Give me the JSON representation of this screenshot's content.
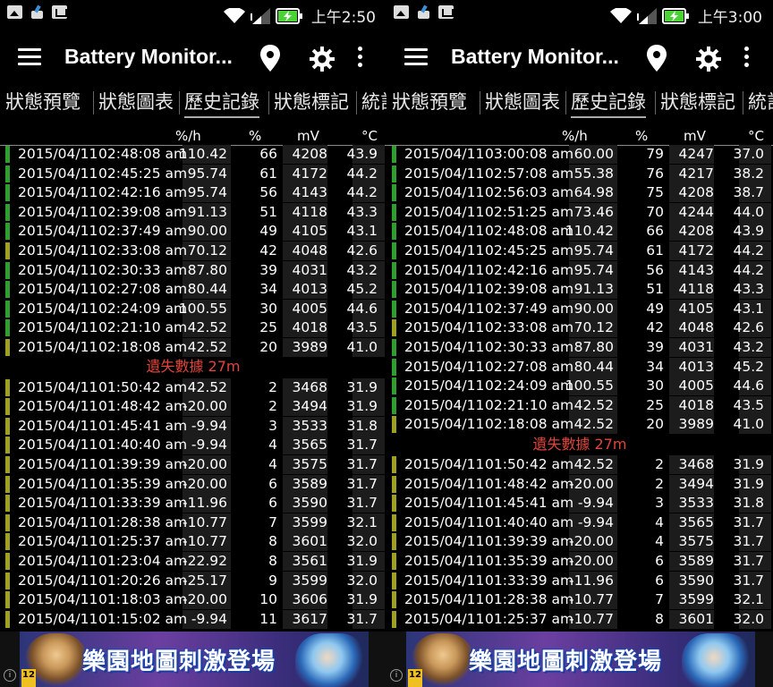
{
  "colors": {
    "bar_green": "#2e9e2e",
    "bar_olive": "#a0a020",
    "missing_text": "#e0453a"
  },
  "screens": [
    {
      "status": {
        "time": "上午2:50"
      },
      "app_title": "Battery Monitor...",
      "tabs": [
        "狀態預覽",
        "狀態圖表",
        "歷史記錄",
        "狀態標記",
        "統計"
      ],
      "active_tab": 2,
      "headers": {
        "rate": "%/h",
        "pct": "%",
        "mv": "mV",
        "temp": "°C"
      },
      "missing_label": "遺失數據 27m",
      "rows_before": [
        {
          "date": "2015/04/11",
          "time": "02:48:08 am",
          "rate": "110.42",
          "pct": "66",
          "mv": "4208",
          "temp": "43.9",
          "bar": "green"
        },
        {
          "date": "2015/04/11",
          "time": "02:45:25 am",
          "rate": "95.74",
          "pct": "61",
          "mv": "4172",
          "temp": "44.2",
          "bar": "green"
        },
        {
          "date": "2015/04/11",
          "time": "02:42:16 am",
          "rate": "95.74",
          "pct": "56",
          "mv": "4143",
          "temp": "44.2",
          "bar": "green"
        },
        {
          "date": "2015/04/11",
          "time": "02:39:08 am",
          "rate": "91.13",
          "pct": "51",
          "mv": "4118",
          "temp": "43.3",
          "bar": "green"
        },
        {
          "date": "2015/04/11",
          "time": "02:37:49 am",
          "rate": "90.00",
          "pct": "49",
          "mv": "4105",
          "temp": "43.1",
          "bar": "green"
        },
        {
          "date": "2015/04/11",
          "time": "02:33:08 am",
          "rate": "70.12",
          "pct": "42",
          "mv": "4048",
          "temp": "42.6",
          "bar": "olive"
        },
        {
          "date": "2015/04/11",
          "time": "02:30:33 am",
          "rate": "87.80",
          "pct": "39",
          "mv": "4031",
          "temp": "43.2",
          "bar": "green"
        },
        {
          "date": "2015/04/11",
          "time": "02:27:08 am",
          "rate": "80.44",
          "pct": "34",
          "mv": "4013",
          "temp": "45.2",
          "bar": "green"
        },
        {
          "date": "2015/04/11",
          "time": "02:24:09 am",
          "rate": "100.55",
          "pct": "30",
          "mv": "4005",
          "temp": "44.6",
          "bar": "green"
        },
        {
          "date": "2015/04/11",
          "time": "02:21:10 am",
          "rate": "42.52",
          "pct": "25",
          "mv": "4018",
          "temp": "43.5",
          "bar": "green"
        },
        {
          "date": "2015/04/11",
          "time": "02:18:08 am",
          "rate": "42.52",
          "pct": "20",
          "mv": "3989",
          "temp": "41.0",
          "bar": "olive"
        }
      ],
      "rows_after": [
        {
          "date": "2015/04/11",
          "time": "01:50:42 am",
          "rate": "42.52",
          "pct": "2",
          "mv": "3468",
          "temp": "31.9",
          "bar": "olive"
        },
        {
          "date": "2015/04/11",
          "time": "01:48:42 am",
          "rate": "-20.00",
          "pct": "2",
          "mv": "3494",
          "temp": "31.9",
          "bar": "olive"
        },
        {
          "date": "2015/04/11",
          "time": "01:45:41 am",
          "rate": "-9.94",
          "pct": "3",
          "mv": "3533",
          "temp": "31.8",
          "bar": "olive"
        },
        {
          "date": "2015/04/11",
          "time": "01:40:40 am",
          "rate": "-9.94",
          "pct": "4",
          "mv": "3565",
          "temp": "31.7",
          "bar": "olive"
        },
        {
          "date": "2015/04/11",
          "time": "01:39:39 am",
          "rate": "-20.00",
          "pct": "4",
          "mv": "3575",
          "temp": "31.7",
          "bar": "olive"
        },
        {
          "date": "2015/04/11",
          "time": "01:35:39 am",
          "rate": "-20.00",
          "pct": "6",
          "mv": "3589",
          "temp": "31.7",
          "bar": "olive"
        },
        {
          "date": "2015/04/11",
          "time": "01:33:39 am",
          "rate": "-11.96",
          "pct": "6",
          "mv": "3590",
          "temp": "31.7",
          "bar": "olive"
        },
        {
          "date": "2015/04/11",
          "time": "01:28:38 am",
          "rate": "-10.77",
          "pct": "7",
          "mv": "3599",
          "temp": "32.1",
          "bar": "olive"
        },
        {
          "date": "2015/04/11",
          "time": "01:25:37 am",
          "rate": "-10.77",
          "pct": "8",
          "mv": "3601",
          "temp": "32.0",
          "bar": "olive"
        },
        {
          "date": "2015/04/11",
          "time": "01:23:04 am",
          "rate": "-22.92",
          "pct": "8",
          "mv": "3561",
          "temp": "31.9",
          "bar": "olive"
        },
        {
          "date": "2015/04/11",
          "time": "01:20:26 am",
          "rate": "-25.17",
          "pct": "9",
          "mv": "3599",
          "temp": "32.0",
          "bar": "olive"
        },
        {
          "date": "2015/04/11",
          "time": "01:18:03 am",
          "rate": "-20.00",
          "pct": "10",
          "mv": "3606",
          "temp": "31.9",
          "bar": "olive"
        },
        {
          "date": "2015/04/11",
          "time": "01:15:02 am",
          "rate": "-9.94",
          "pct": "11",
          "mv": "3617",
          "temp": "31.7",
          "bar": "olive"
        }
      ],
      "ad": {
        "text": "樂園地圖刺激登場",
        "rating": "12",
        "info": "i"
      }
    },
    {
      "status": {
        "time": "上午3:00"
      },
      "app_title": "Battery Monitor...",
      "tabs": [
        "狀態預覽",
        "狀態圖表",
        "歷史記錄",
        "狀態標記",
        "統計"
      ],
      "active_tab": 2,
      "headers": {
        "rate": "%/h",
        "pct": "%",
        "mv": "mV",
        "temp": "°C"
      },
      "missing_label": "遺失數據 27m",
      "rows_before": [
        {
          "date": "2015/04/11",
          "time": "03:00:08 am",
          "rate": "60.00",
          "pct": "79",
          "mv": "4247",
          "temp": "37.0",
          "bar": "green"
        },
        {
          "date": "2015/04/11",
          "time": "02:57:08 am",
          "rate": "55.38",
          "pct": "76",
          "mv": "4217",
          "temp": "38.2",
          "bar": "green"
        },
        {
          "date": "2015/04/11",
          "time": "02:56:03 am",
          "rate": "64.98",
          "pct": "75",
          "mv": "4208",
          "temp": "38.7",
          "bar": "green"
        },
        {
          "date": "2015/04/11",
          "time": "02:51:25 am",
          "rate": "73.46",
          "pct": "70",
          "mv": "4244",
          "temp": "44.0",
          "bar": "green"
        },
        {
          "date": "2015/04/11",
          "time": "02:48:08 am",
          "rate": "110.42",
          "pct": "66",
          "mv": "4208",
          "temp": "43.9",
          "bar": "green"
        },
        {
          "date": "2015/04/11",
          "time": "02:45:25 am",
          "rate": "95.74",
          "pct": "61",
          "mv": "4172",
          "temp": "44.2",
          "bar": "green"
        },
        {
          "date": "2015/04/11",
          "time": "02:42:16 am",
          "rate": "95.74",
          "pct": "56",
          "mv": "4143",
          "temp": "44.2",
          "bar": "green"
        },
        {
          "date": "2015/04/11",
          "time": "02:39:08 am",
          "rate": "91.13",
          "pct": "51",
          "mv": "4118",
          "temp": "43.3",
          "bar": "green"
        },
        {
          "date": "2015/04/11",
          "time": "02:37:49 am",
          "rate": "90.00",
          "pct": "49",
          "mv": "4105",
          "temp": "43.1",
          "bar": "green"
        },
        {
          "date": "2015/04/11",
          "time": "02:33:08 am",
          "rate": "70.12",
          "pct": "42",
          "mv": "4048",
          "temp": "42.6",
          "bar": "olive"
        },
        {
          "date": "2015/04/11",
          "time": "02:30:33 am",
          "rate": "87.80",
          "pct": "39",
          "mv": "4031",
          "temp": "43.2",
          "bar": "green"
        },
        {
          "date": "2015/04/11",
          "time": "02:27:08 am",
          "rate": "80.44",
          "pct": "34",
          "mv": "4013",
          "temp": "45.2",
          "bar": "green"
        },
        {
          "date": "2015/04/11",
          "time": "02:24:09 am",
          "rate": "100.55",
          "pct": "30",
          "mv": "4005",
          "temp": "44.6",
          "bar": "green"
        },
        {
          "date": "2015/04/11",
          "time": "02:21:10 am",
          "rate": "42.52",
          "pct": "25",
          "mv": "4018",
          "temp": "43.5",
          "bar": "green"
        },
        {
          "date": "2015/04/11",
          "time": "02:18:08 am",
          "rate": "42.52",
          "pct": "20",
          "mv": "3989",
          "temp": "41.0",
          "bar": "olive"
        }
      ],
      "rows_after": [
        {
          "date": "2015/04/11",
          "time": "01:50:42 am",
          "rate": "42.52",
          "pct": "2",
          "mv": "3468",
          "temp": "31.9",
          "bar": "olive"
        },
        {
          "date": "2015/04/11",
          "time": "01:48:42 am",
          "rate": "-20.00",
          "pct": "2",
          "mv": "3494",
          "temp": "31.9",
          "bar": "olive"
        },
        {
          "date": "2015/04/11",
          "time": "01:45:41 am",
          "rate": "-9.94",
          "pct": "3",
          "mv": "3533",
          "temp": "31.8",
          "bar": "olive"
        },
        {
          "date": "2015/04/11",
          "time": "01:40:40 am",
          "rate": "-9.94",
          "pct": "4",
          "mv": "3565",
          "temp": "31.7",
          "bar": "olive"
        },
        {
          "date": "2015/04/11",
          "time": "01:39:39 am",
          "rate": "-20.00",
          "pct": "4",
          "mv": "3575",
          "temp": "31.7",
          "bar": "olive"
        },
        {
          "date": "2015/04/11",
          "time": "01:35:39 am",
          "rate": "-20.00",
          "pct": "6",
          "mv": "3589",
          "temp": "31.7",
          "bar": "olive"
        },
        {
          "date": "2015/04/11",
          "time": "01:33:39 am",
          "rate": "-11.96",
          "pct": "6",
          "mv": "3590",
          "temp": "31.7",
          "bar": "olive"
        },
        {
          "date": "2015/04/11",
          "time": "01:28:38 am",
          "rate": "-10.77",
          "pct": "7",
          "mv": "3599",
          "temp": "32.1",
          "bar": "olive"
        },
        {
          "date": "2015/04/11",
          "time": "01:25:37 am",
          "rate": "-10.77",
          "pct": "8",
          "mv": "3601",
          "temp": "32.0",
          "bar": "olive"
        }
      ],
      "ad": {
        "text": "樂園地圖刺激登場",
        "rating": "12",
        "info": "i"
      }
    }
  ]
}
